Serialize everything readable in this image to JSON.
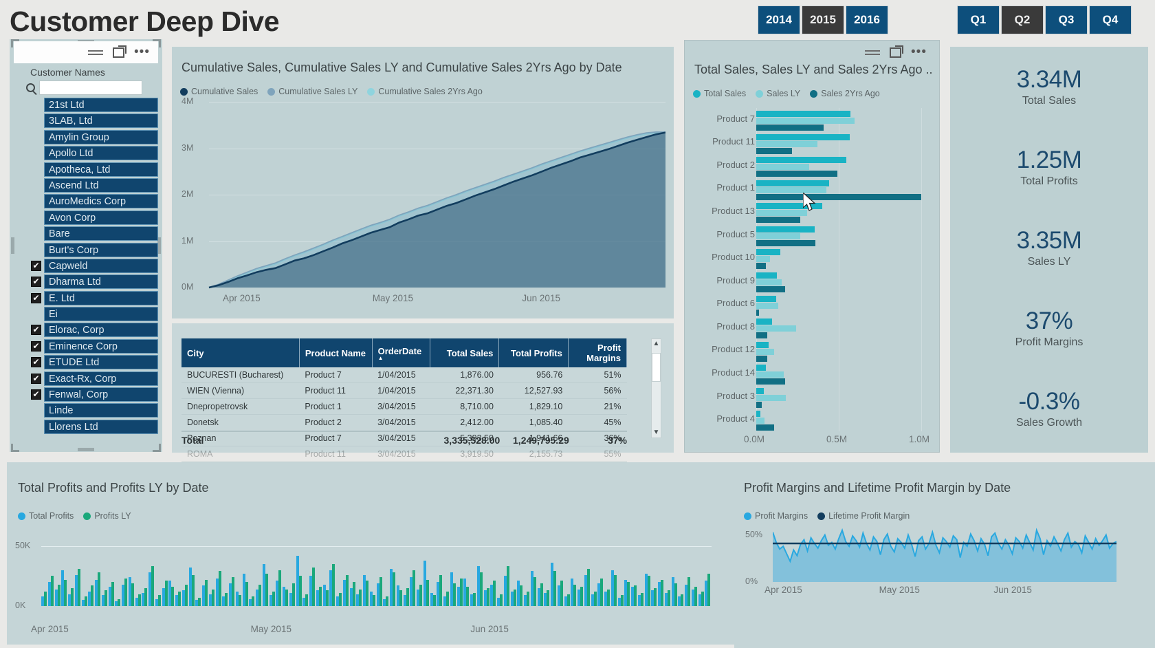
{
  "header": {
    "title": "Customer Deep Dive",
    "year_filter": {
      "name": "year-filter",
      "options": [
        "2014",
        "2015",
        "2016"
      ],
      "selected": "2015"
    },
    "quarter_filter": {
      "name": "quarter-filter",
      "options": [
        "Q1",
        "Q2",
        "Q3",
        "Q4"
      ],
      "selected": "Q2"
    }
  },
  "slicer": {
    "label": "Customer Names",
    "search_value": "",
    "search_placeholder": "",
    "icons": [
      "filter-lines-icon",
      "focus-mode-icon",
      "more-options-icon",
      "search-icon"
    ],
    "items": [
      {
        "label": "21st Ltd",
        "checked": false
      },
      {
        "label": "3LAB, Ltd",
        "checked": false
      },
      {
        "label": "Amylin Group",
        "checked": false
      },
      {
        "label": "Apollo Ltd",
        "checked": false
      },
      {
        "label": "Apotheca, Ltd",
        "checked": false
      },
      {
        "label": "Ascend Ltd",
        "checked": false
      },
      {
        "label": "AuroMedics Corp",
        "checked": false
      },
      {
        "label": "Avon Corp",
        "checked": false
      },
      {
        "label": "Bare",
        "checked": false
      },
      {
        "label": "Burt's Corp",
        "checked": false
      },
      {
        "label": "Capweld",
        "checked": true
      },
      {
        "label": "Dharma Ltd",
        "checked": true
      },
      {
        "label": "E. Ltd",
        "checked": true
      },
      {
        "label": "Ei",
        "checked": false
      },
      {
        "label": "Elorac, Corp",
        "checked": true
      },
      {
        "label": "Eminence Corp",
        "checked": true
      },
      {
        "label": "ETUDE Ltd",
        "checked": true
      },
      {
        "label": "Exact-Rx, Corp",
        "checked": true
      },
      {
        "label": "Fenwal, Corp",
        "checked": true
      },
      {
        "label": "Linde",
        "checked": false
      },
      {
        "label": "Llorens Ltd",
        "checked": false
      }
    ]
  },
  "table": {
    "columns": [
      "City",
      "Product Name",
      "OrderDate",
      "Total Sales",
      "Total Profits",
      "Profit Margins"
    ],
    "sorted_column": "OrderDate",
    "rows": [
      [
        "BUCURESTI (Bucharest)",
        "Product 7",
        "1/04/2015",
        "1,876.00",
        "956.76",
        "51%"
      ],
      [
        "WIEN (Vienna)",
        "Product 11",
        "1/04/2015",
        "22,371.30",
        "12,527.93",
        "56%"
      ],
      [
        "Dnepropetrovsk",
        "Product 1",
        "3/04/2015",
        "8,710.00",
        "1,829.10",
        "21%"
      ],
      [
        "Donetsk",
        "Product 2",
        "3/04/2015",
        "2,412.00",
        "1,085.40",
        "45%"
      ],
      [
        "Poznan",
        "Product 7",
        "3/04/2015",
        "5,393.50",
        "1,941.66",
        "36%"
      ],
      [
        "ROMA",
        "Product 11",
        "3/04/2015",
        "3,919.50",
        "2,155.73",
        "55%"
      ]
    ],
    "total_label": "Total",
    "total_sales": "3,335,528.00",
    "total_profits": "1,249,795.29",
    "total_margins": "37%"
  },
  "kpis": [
    {
      "value": "3.34M",
      "label": "Total Sales"
    },
    {
      "value": "1.25M",
      "label": "Total Profits"
    },
    {
      "value": "3.35M",
      "label": "Sales LY"
    },
    {
      "value": "37%",
      "label": "Profit Margins"
    },
    {
      "value": "-0.3%",
      "label": "Sales Growth"
    }
  ],
  "colors": {
    "header_blue": "#0d4f7c",
    "selected_gray": "#3a3a3a",
    "panel_bg": "#c0d2d4",
    "kpi_value": "#1c4a6e",
    "teal": "#19b3c4",
    "teal_light": "#7fd0d8",
    "teal_dark": "#116f84",
    "navy": "#123d5e",
    "steel": "#7fa4bc",
    "sky": "#8fd4de",
    "blue_bright": "#28a8e0",
    "green": "#1aa87b"
  },
  "chart_data": [
    {
      "name": "cumulative-sales-chart",
      "type": "area",
      "title": "Cumulative Sales, Cumulative Sales LY and Cumulative Sales 2Yrs Ago by Date",
      "xlabel": "",
      "ylabel": "",
      "ylim": [
        0,
        4000000
      ],
      "yticks": [
        "0M",
        "1M",
        "2M",
        "3M",
        "4M"
      ],
      "xticks": [
        "Apr 2015",
        "May 2015",
        "Jun 2015"
      ],
      "grid": true,
      "legend": [
        {
          "name": "Cumulative Sales",
          "color": "#123d5e"
        },
        {
          "name": "Cumulative Sales LY",
          "color": "#7fa4bc"
        },
        {
          "name": "Cumulative Sales 2Yrs Ago",
          "color": "#8fd4de"
        }
      ],
      "series": [
        {
          "name": "Cumulative Sales",
          "color": "#123d5e",
          "values": [
            0.0,
            0.05,
            0.12,
            0.2,
            0.26,
            0.33,
            0.38,
            0.42,
            0.5,
            0.58,
            0.63,
            0.7,
            0.78,
            0.86,
            0.95,
            1.02,
            1.1,
            1.18,
            1.24,
            1.3,
            1.4,
            1.47,
            1.55,
            1.6,
            1.68,
            1.76,
            1.82,
            1.9,
            1.98,
            2.05,
            2.12,
            2.2,
            2.28,
            2.35,
            2.42,
            2.5,
            2.58,
            2.65,
            2.72,
            2.8,
            2.86,
            2.92,
            2.98,
            3.05,
            3.12,
            3.18,
            3.24,
            3.3,
            3.34
          ]
        },
        {
          "name": "Cumulative Sales LY",
          "color": "#7fa4bc",
          "values": [
            0.0,
            0.07,
            0.16,
            0.25,
            0.33,
            0.41,
            0.47,
            0.53,
            0.62,
            0.7,
            0.77,
            0.85,
            0.93,
            1.02,
            1.1,
            1.18,
            1.26,
            1.34,
            1.4,
            1.47,
            1.56,
            1.63,
            1.71,
            1.77,
            1.85,
            1.93,
            2.0,
            2.08,
            2.15,
            2.22,
            2.29,
            2.37,
            2.44,
            2.51,
            2.58,
            2.66,
            2.73,
            2.8,
            2.87,
            2.94,
            3.0,
            3.06,
            3.12,
            3.18,
            3.24,
            3.29,
            3.33,
            3.35,
            3.35
          ]
        },
        {
          "name": "Cumulative Sales 2Yrs Ago",
          "color": "#8fd4de",
          "values": [
            0.0,
            0.06,
            0.14,
            0.23,
            0.31,
            0.39,
            0.45,
            0.51,
            0.6,
            0.68,
            0.75,
            0.83,
            0.91,
            1.0,
            1.08,
            1.16,
            1.24,
            1.32,
            1.38,
            1.45,
            1.54,
            1.61,
            1.69,
            1.75,
            1.83,
            1.91,
            1.98,
            2.06,
            2.13,
            2.2,
            2.27,
            2.35,
            2.42,
            2.49,
            2.56,
            2.64,
            2.71,
            2.78,
            2.85,
            2.92,
            2.98,
            3.04,
            3.1,
            3.16,
            3.22,
            3.27,
            3.31,
            3.33,
            3.34
          ]
        }
      ]
    },
    {
      "name": "product-sales-bar-chart",
      "type": "bar",
      "orientation": "horizontal",
      "title": "Total Sales, Sales LY and Sales 2Yrs Ago ...",
      "xlabel": "",
      "ylabel": "",
      "xlim": [
        0,
        1000000
      ],
      "xticks": [
        "0.0M",
        "0.5M",
        "1.0M"
      ],
      "categories": [
        "Product 7",
        "Product 11",
        "Product 2",
        "Product 1",
        "Product 13",
        "Product 5",
        "Product 10",
        "Product 9",
        "Product 6",
        "Product 8",
        "Product 12",
        "Product 14",
        "Product 3",
        "Product 4"
      ],
      "legend": [
        {
          "name": "Total Sales",
          "color": "#19b3c4"
        },
        {
          "name": "Sales LY",
          "color": "#7fd0d8"
        },
        {
          "name": "Sales 2Yrs Ago",
          "color": "#116f84"
        }
      ],
      "series": [
        {
          "name": "Total Sales",
          "color": "#19b3c4",
          "values": [
            570000,
            565000,
            545000,
            440000,
            400000,
            355000,
            145000,
            125000,
            120000,
            95000,
            75000,
            60000,
            45000,
            25000
          ]
        },
        {
          "name": "Sales LY",
          "color": "#7fd0d8",
          "values": [
            595000,
            370000,
            320000,
            425000,
            310000,
            265000,
            85000,
            155000,
            135000,
            240000,
            110000,
            165000,
            180000,
            50000
          ]
        },
        {
          "name": "Sales 2Yrs Ago",
          "color": "#116f84",
          "values": [
            410000,
            215000,
            490000,
            1000000,
            265000,
            360000,
            60000,
            175000,
            15000,
            65000,
            65000,
            175000,
            35000,
            110000
          ]
        }
      ]
    },
    {
      "name": "total-profits-chart",
      "type": "bar",
      "title": "Total Profits and Profits LY by Date",
      "xlabel": "",
      "ylabel": "",
      "ylim": [
        0,
        60000
      ],
      "yticks": [
        "0K",
        "50K"
      ],
      "xticks": [
        "Apr 2015",
        "May 2015",
        "Jun 2015"
      ],
      "legend": [
        {
          "name": "Total Profits",
          "color": "#28a8e0"
        },
        {
          "name": "Profits LY",
          "color": "#1aa87b"
        }
      ],
      "series": [
        {
          "name": "Total Profits",
          "color": "#28a8e0",
          "values": [
            8,
            20,
            14,
            30,
            10,
            26,
            5,
            12,
            22,
            9,
            16,
            4,
            18,
            24,
            7,
            11,
            28,
            6,
            15,
            21,
            9,
            13,
            32,
            5,
            17,
            10,
            23,
            8,
            19,
            12,
            27,
            6,
            14,
            35,
            9,
            21,
            16,
            11,
            42,
            7,
            25,
            13,
            18,
            30,
            8,
            22,
            15,
            10,
            26,
            12,
            19,
            6,
            31,
            17,
            9,
            24,
            14,
            38,
            11,
            20,
            8,
            28,
            16,
            23,
            10,
            33,
            13,
            18,
            7,
            25,
            12,
            21,
            9,
            29,
            15,
            11,
            36,
            17,
            8,
            23,
            14,
            26,
            10,
            19,
            12,
            30,
            7,
            22,
            16,
            9,
            27,
            13,
            20,
            11,
            24,
            8,
            18,
            14,
            10,
            21
          ]
        },
        {
          "name": "Profits LY",
          "color": "#1aa87b",
          "values": [
            12,
            25,
            18,
            22,
            15,
            31,
            8,
            17,
            28,
            13,
            20,
            6,
            23,
            19,
            10,
            15,
            33,
            9,
            21,
            16,
            12,
            18,
            26,
            7,
            22,
            14,
            29,
            11,
            24,
            9,
            20,
            8,
            18,
            27,
            12,
            30,
            14,
            19,
            25,
            10,
            32,
            16,
            13,
            35,
            11,
            26,
            20,
            14,
            21,
            9,
            24,
            8,
            28,
            13,
            15,
            30,
            18,
            22,
            9,
            26,
            12,
            19,
            23,
            16,
            11,
            28,
            15,
            21,
            10,
            33,
            14,
            17,
            12,
            24,
            19,
            13,
            29,
            21,
            10,
            18,
            16,
            31,
            12,
            23,
            14,
            26,
            9,
            20,
            17,
            11,
            25,
            15,
            22,
            13,
            19,
            10,
            24,
            16,
            12,
            27
          ]
        }
      ]
    },
    {
      "name": "profit-margins-chart",
      "type": "area",
      "title": "Profit Margins and Lifetime Profit Margin by Date",
      "xlabel": "",
      "ylabel": "",
      "ylim": [
        0,
        0.6
      ],
      "yticks": [
        "0%",
        "50%"
      ],
      "xticks": [
        "Apr 2015",
        "May 2015",
        "Jun 2015"
      ],
      "legend": [
        {
          "name": "Profit Margins",
          "color": "#28a8e0"
        },
        {
          "name": "Lifetime Profit Margin",
          "color": "#123d5e"
        }
      ],
      "series": [
        {
          "name": "Profit Margins",
          "color": "#28a8e0",
          "values": [
            0.53,
            0.42,
            0.35,
            0.38,
            0.3,
            0.22,
            0.34,
            0.28,
            0.4,
            0.45,
            0.33,
            0.47,
            0.41,
            0.36,
            0.44,
            0.5,
            0.39,
            0.42,
            0.35,
            0.46,
            0.55,
            0.43,
            0.38,
            0.49,
            0.44,
            0.37,
            0.52,
            0.41,
            0.34,
            0.48,
            0.43,
            0.29,
            0.45,
            0.51,
            0.38,
            0.32,
            0.46,
            0.42,
            0.36,
            0.5,
            0.4,
            0.27,
            0.44,
            0.48,
            0.35,
            0.41,
            0.53,
            0.39,
            0.31,
            0.47,
            0.43,
            0.37,
            0.49,
            0.45,
            0.26,
            0.42,
            0.38,
            0.51,
            0.44,
            0.33,
            0.46,
            0.4,
            0.28,
            0.48,
            0.52,
            0.41,
            0.35,
            0.45,
            0.39,
            0.3,
            0.47,
            0.43,
            0.36,
            0.5,
            0.42,
            0.34,
            0.55,
            0.46,
            0.29,
            0.44,
            0.38,
            0.48,
            0.41,
            0.33,
            0.45,
            0.52,
            0.37,
            0.43,
            0.4,
            0.31,
            0.49,
            0.42,
            0.35,
            0.46,
            0.39,
            0.44,
            0.5,
            0.36,
            0.41,
            0.43
          ]
        },
        {
          "name": "Lifetime Profit Margin",
          "color": "#123d5e",
          "constant": 0.41
        }
      ]
    }
  ]
}
